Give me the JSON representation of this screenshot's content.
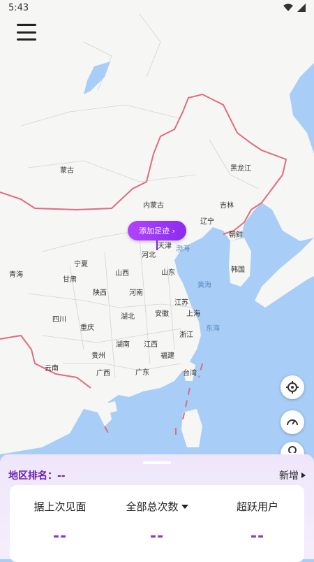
{
  "status_bar": {
    "time": "5:43"
  },
  "map": {
    "labels": [
      {
        "text": "蒙古",
        "sea": false
      },
      {
        "text": "内蒙古",
        "sea": false
      },
      {
        "text": "黑龙江",
        "sea": false
      },
      {
        "text": "吉林",
        "sea": false
      },
      {
        "text": "辽宁",
        "sea": false
      },
      {
        "text": "朝鲜",
        "sea": false
      },
      {
        "text": "天津",
        "sea": false
      },
      {
        "text": "河北",
        "sea": false
      },
      {
        "text": "渤海",
        "sea": true
      },
      {
        "text": "韩国",
        "sea": false
      },
      {
        "text": "宁夏",
        "sea": false
      },
      {
        "text": "山西",
        "sea": false
      },
      {
        "text": "山东",
        "sea": false
      },
      {
        "text": "黄海",
        "sea": true
      },
      {
        "text": "青海",
        "sea": false
      },
      {
        "text": "甘肃",
        "sea": false
      },
      {
        "text": "陕西",
        "sea": false
      },
      {
        "text": "河南",
        "sea": false
      },
      {
        "text": "江苏",
        "sea": false
      },
      {
        "text": "安徽",
        "sea": false
      },
      {
        "text": "上海",
        "sea": false
      },
      {
        "text": "湖北",
        "sea": false
      },
      {
        "text": "四川",
        "sea": false
      },
      {
        "text": "重庆",
        "sea": false
      },
      {
        "text": "东海",
        "sea": true
      },
      {
        "text": "浙江",
        "sea": false
      },
      {
        "text": "湖南",
        "sea": false
      },
      {
        "text": "江西",
        "sea": false
      },
      {
        "text": "贵州",
        "sea": false
      },
      {
        "text": "福建",
        "sea": false
      },
      {
        "text": "云南",
        "sea": false
      },
      {
        "text": "广西",
        "sea": false
      },
      {
        "text": "广东",
        "sea": false
      },
      {
        "text": "台湾",
        "sea": false
      }
    ]
  },
  "add_footprint_button": {
    "label": "添加足迹 ›"
  },
  "icons": {
    "menu": "menu-icon",
    "locate": "crosshair-icon",
    "speed": "speedometer-icon",
    "search": "search-icon"
  },
  "panel": {
    "rank_label": "地区排名：--",
    "new_label": "新增",
    "stats": [
      {
        "label": "据上次见面",
        "value": "--"
      },
      {
        "label": "全部总次数",
        "value": "--"
      },
      {
        "label": "超跃用户",
        "value": "--"
      }
    ]
  },
  "colors": {
    "accent": "#8a33d6",
    "border_line": "#e06c7f",
    "sea": "#a8cdf6",
    "land": "#f6f6f4"
  }
}
